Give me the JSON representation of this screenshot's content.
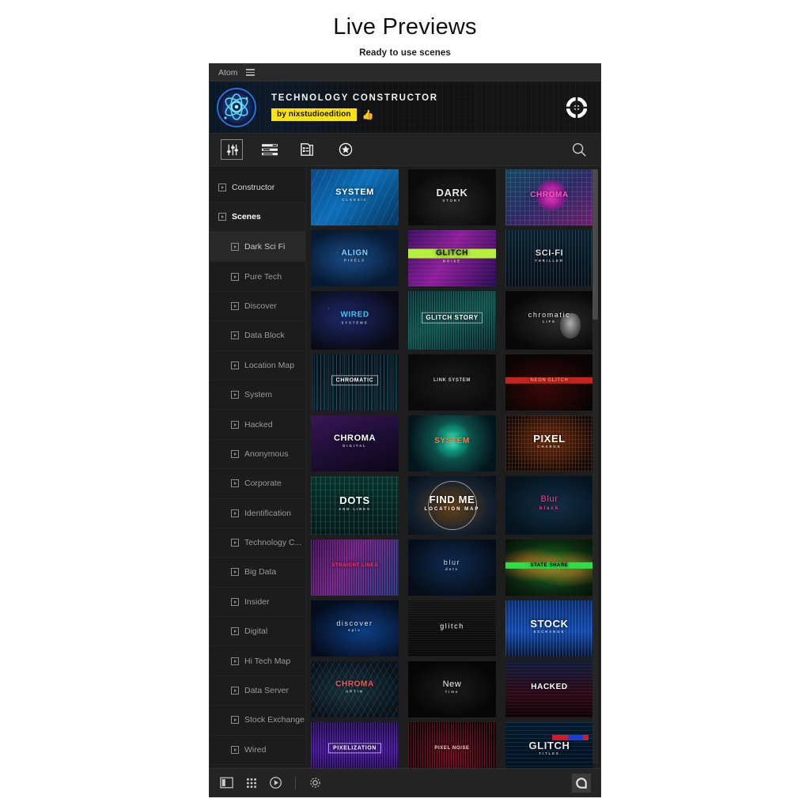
{
  "page": {
    "title": "Live Previews",
    "subtitle": "Ready to use scenes"
  },
  "window": {
    "app_name": "Atom",
    "menu_icon": "hamburger-icon"
  },
  "banner": {
    "logo_icon": "atom-logo-icon",
    "product_title": "TECHNOLOGY CONSTRUCTOR",
    "author_badge": "by nixstudioedition",
    "like_icon": "thumbs-up-icon",
    "target_icon": "target-crosshair-icon",
    "badge_color": "#ffe400"
  },
  "toolbar": {
    "items": [
      {
        "name": "sliders-icon",
        "label": "Controls",
        "active": true
      },
      {
        "name": "layers-icon",
        "label": "Layers",
        "active": false
      },
      {
        "name": "document-icon",
        "label": "Presets",
        "active": false
      },
      {
        "name": "star-icon",
        "label": "Favorites",
        "active": false
      }
    ],
    "search_icon": "search-icon"
  },
  "sidebar": {
    "roots": [
      {
        "label": "Constructor",
        "active": false
      },
      {
        "label": "Scenes",
        "active": true
      }
    ],
    "items": [
      {
        "label": "Dark Sci Fi",
        "selected": true
      },
      {
        "label": "Pure Tech",
        "selected": false
      },
      {
        "label": "Discover",
        "selected": false
      },
      {
        "label": "Data Block",
        "selected": false
      },
      {
        "label": "Location Map",
        "selected": false
      },
      {
        "label": "System",
        "selected": false
      },
      {
        "label": "Hacked",
        "selected": false
      },
      {
        "label": "Anonymous",
        "selected": false
      },
      {
        "label": "Corporate",
        "selected": false
      },
      {
        "label": "Identification",
        "selected": false
      },
      {
        "label": "Technology C...",
        "selected": false
      },
      {
        "label": "Big Data",
        "selected": false
      },
      {
        "label": "Insider",
        "selected": false
      },
      {
        "label": "Digital",
        "selected": false
      },
      {
        "label": "Hi Tech Map",
        "selected": false
      },
      {
        "label": "Data Server",
        "selected": false
      },
      {
        "label": "Stock Exchange",
        "selected": false
      },
      {
        "label": "Wired",
        "selected": false
      }
    ]
  },
  "scenes": [
    {
      "title": "SYSTEM",
      "sub": "CLASSIC",
      "color": "#ffffff",
      "bg": "sys-blue"
    },
    {
      "title": "DARK",
      "sub": "STORY",
      "color": "#e8e8e8",
      "bg": "dark-particles"
    },
    {
      "title": "CHROMA",
      "sub": "",
      "color": "#ff52c8",
      "bg": "chroma-grid"
    },
    {
      "title": "ALIGN",
      "sub": "PIXELS",
      "color": "#7fd4ff",
      "bg": "align-blue"
    },
    {
      "title": "GLITCH",
      "sub": "NOISE",
      "color": "#0c0c0c",
      "bg": "glitch-purple"
    },
    {
      "title": "SCI-FI",
      "sub": "THRILLER",
      "color": "#dcdcdc",
      "bg": "scifi-dark"
    },
    {
      "title": "WIRED",
      "sub": "SYSTEMS",
      "color": "#39c6ff",
      "bg": "wired-space"
    },
    {
      "title": "GLITCH STORY",
      "sub": "",
      "color": "#ffffff",
      "bg": "glitch-green"
    },
    {
      "title": "chromatic",
      "sub": "LIFE",
      "color": "#e6e6e6",
      "bg": "anon-mask"
    },
    {
      "title": "CHROMATIC",
      "sub": "",
      "color": "#ffffff",
      "bg": "chromatic-wave"
    },
    {
      "title": "LINK SYSTEM",
      "sub": "",
      "color": "#cfcfcf",
      "bg": "link-dark"
    },
    {
      "title": "NEON GLITCH",
      "sub": "",
      "color": "#ff8a6a",
      "bg": "red-glitch"
    },
    {
      "title": "CHROMA",
      "sub": "DIGITAL",
      "color": "#ffffff",
      "bg": "chroma-purple"
    },
    {
      "title": "SYSTEM",
      "sub": "",
      "color": "#ff7a3a",
      "bg": "system-orb"
    },
    {
      "title": "PIXEL",
      "sub": "CHARGE",
      "color": "#ffffff",
      "bg": "pixel-orange"
    },
    {
      "title": "DOTS",
      "sub": "AND LINES",
      "color": "#ffffff",
      "bg": "dots-teal"
    },
    {
      "title": "FIND ME",
      "sub": "LOCATION MAP",
      "color": "#ffffff",
      "bg": "findme-map"
    },
    {
      "title": "Blur",
      "sub": "black",
      "color": "#ff3b8a",
      "bg": "blur-black"
    },
    {
      "title": "STRAIGHT LINES",
      "sub": "",
      "color": "#ff3355",
      "bg": "lines-magenta"
    },
    {
      "title": "blur",
      "sub": "dots",
      "color": "#cfd8e0",
      "bg": "blur-dots"
    },
    {
      "title": "STATE SHARE",
      "sub": "",
      "color": "#0a0a0a",
      "bg": "world-green"
    },
    {
      "title": "discover",
      "sub": "epic",
      "color": "#dfe6ee",
      "bg": "discover-blue"
    },
    {
      "title": "glitch",
      "sub": "",
      "color": "#ffffff",
      "bg": "glitch-mono"
    },
    {
      "title": "STOCK",
      "sub": "EXCHANGE",
      "color": "#ffffff",
      "bg": "stock-blue"
    },
    {
      "title": "CHROMA",
      "sub": "ARTIN",
      "color": "#ff5555",
      "bg": "chroma-cyanred"
    },
    {
      "title": "New",
      "sub": "Time",
      "color": "#f0f0f0",
      "bg": "new-time"
    },
    {
      "title": "HACKED",
      "sub": "",
      "color": "#ffffff",
      "bg": "hacked-red"
    },
    {
      "title": "PIXELIZATION",
      "sub": "",
      "color": "#ffffff",
      "bg": "pixelization"
    },
    {
      "title": "PIXEL NOISE",
      "sub": "",
      "color": "#ffd0d0",
      "bg": "pixel-red"
    },
    {
      "title": "GLITCH",
      "sub": "TITLES",
      "color": "#e8e8e8",
      "bg": "glitch-bars"
    }
  ],
  "bottombar": {
    "items": [
      {
        "name": "panel-icon",
        "label": "Panel view"
      },
      {
        "name": "grid-icon",
        "label": "Grid view"
      },
      {
        "name": "play-icon",
        "label": "Preview"
      },
      {
        "name": "gear-icon",
        "label": "Settings"
      }
    ],
    "logo": "atom-badge-icon"
  }
}
